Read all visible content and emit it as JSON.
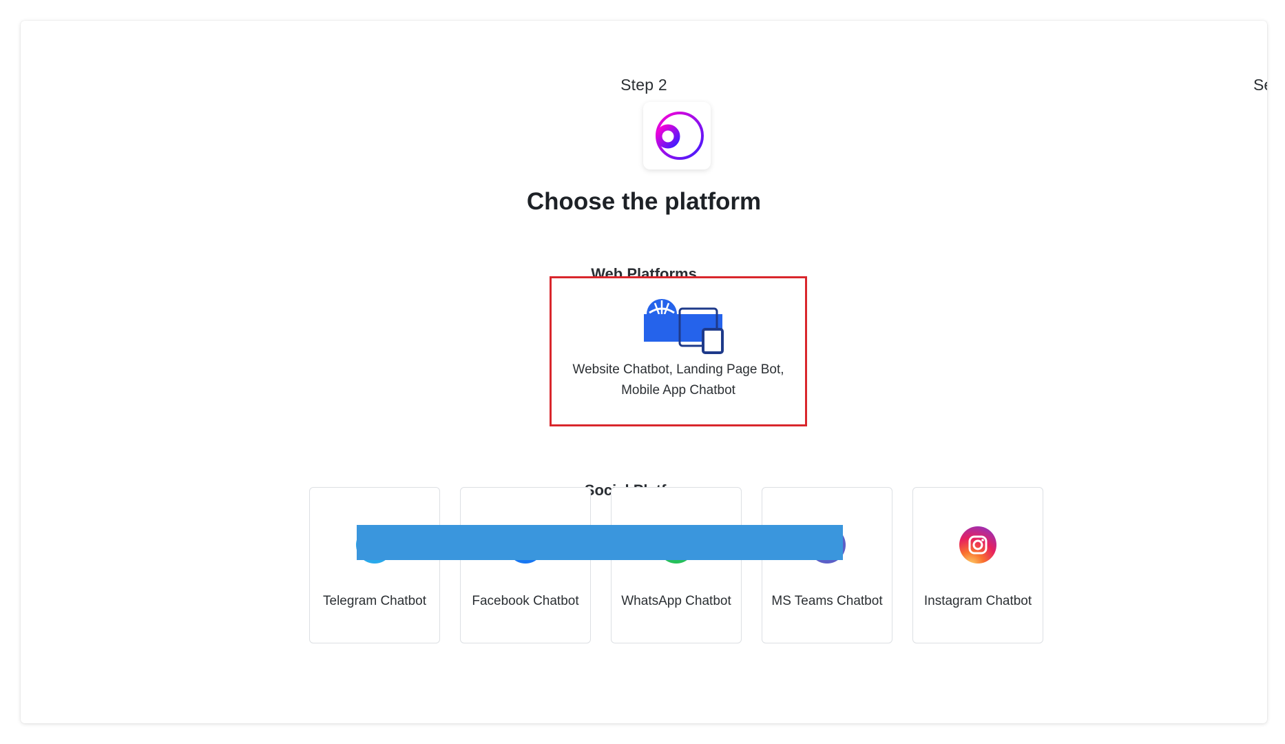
{
  "header": {
    "step_label": "Step 2",
    "next_step_partial": "Se"
  },
  "page": {
    "title": "Choose the platform"
  },
  "web_section": {
    "heading": "Web Platforms",
    "card": {
      "icon": "globe-devices-icon",
      "line1": "Website Chatbot, Landing Page Bot,",
      "line2": "Mobile App Chatbot",
      "selected": true
    }
  },
  "social_section": {
    "heading": "Social Platforms",
    "cards": [
      {
        "label": "Telegram Chatbot",
        "icon": "telegram-icon"
      },
      {
        "label": "Facebook Chatbot",
        "icon": "facebook-icon"
      },
      {
        "label": "WhatsApp Chatbot",
        "icon": "whatsapp-icon"
      },
      {
        "label": "MS Teams Chatbot",
        "icon": "ms-teams-icon"
      },
      {
        "label": "Instagram Chatbot",
        "icon": "instagram-icon"
      }
    ]
  },
  "colors": {
    "selection_border": "#d9262c",
    "web_icon_blue": "#2563eb",
    "web_icon_dark": "#1e3a8a",
    "redaction_blue": "#3a96dd",
    "logo_gradient_start": "#ff00d4",
    "logo_gradient_end": "#3b1cff"
  }
}
